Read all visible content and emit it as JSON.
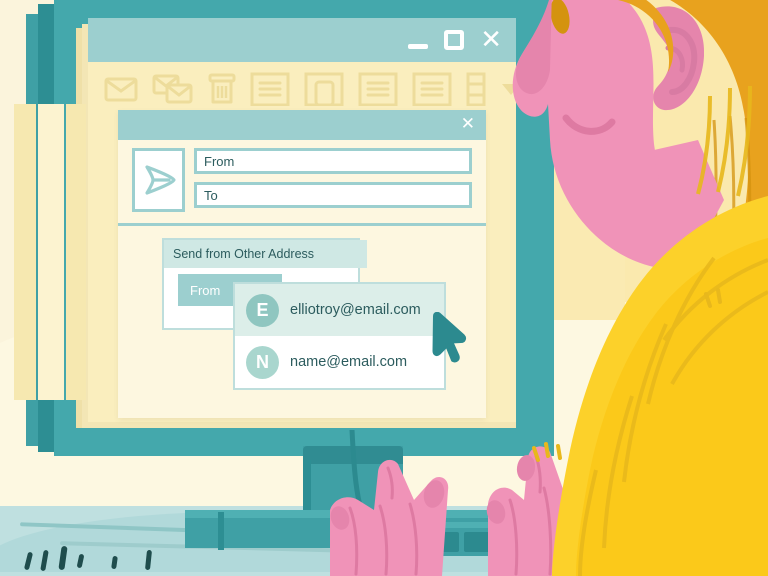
{
  "scene": {
    "description": "Illustration of a person at a desktop computer choosing a send-from email address",
    "colors": {
      "background_cream": "#FDF8E1",
      "background_yellow": "#FAE9AE",
      "monitor_teal": "#44A8AC",
      "accent_teal": "#2C8A8F",
      "titlebar_teal": "#9CCFCF",
      "window_yellow": "#FAEEBE",
      "skin_pink": "#F093B8",
      "sweater_yellow": "#FCD12A",
      "hair_gold": "#E8A21E",
      "desk_blue": "#BFE0E0"
    }
  },
  "mail_window": {
    "titlebar": {
      "minimize_label": "—",
      "maximize_label": "□",
      "close_label": "✕"
    },
    "toolbar_icons": [
      {
        "name": "envelope-icon",
        "label": "New Message"
      },
      {
        "name": "envelopes-icon",
        "label": "Forward"
      },
      {
        "name": "trash-icon",
        "label": "Delete"
      },
      {
        "name": "list-view-icon",
        "label": "List View"
      },
      {
        "name": "reading-pane-icon",
        "label": "Reading Pane"
      },
      {
        "name": "list-icon",
        "label": "Compact List"
      },
      {
        "name": "list-alt-icon",
        "label": "Detailed List"
      },
      {
        "name": "split-view-icon",
        "label": "Split View"
      },
      {
        "name": "chevron-down-icon",
        "label": "More"
      }
    ]
  },
  "compose_modal": {
    "close_label": "✕",
    "send_icon_name": "send-paper-plane-icon",
    "fields": [
      {
        "name": "from-field",
        "value": "From",
        "placeholder": "From"
      },
      {
        "name": "to-field",
        "value": "To",
        "placeholder": "To"
      }
    ]
  },
  "send_from_panel": {
    "header": "Send from Other Address",
    "from_label": "From"
  },
  "address_dropdown": {
    "items": [
      {
        "initial": "E",
        "email": "elliotroy@email.com",
        "selected": true,
        "avatar_color": "#8FC6C0"
      },
      {
        "initial": "N",
        "email": "name@email.com",
        "selected": false,
        "avatar_color": "#A9D6CE"
      }
    ]
  },
  "cursor": {
    "name": "mouse-pointer",
    "color": "#2C8A8F"
  }
}
